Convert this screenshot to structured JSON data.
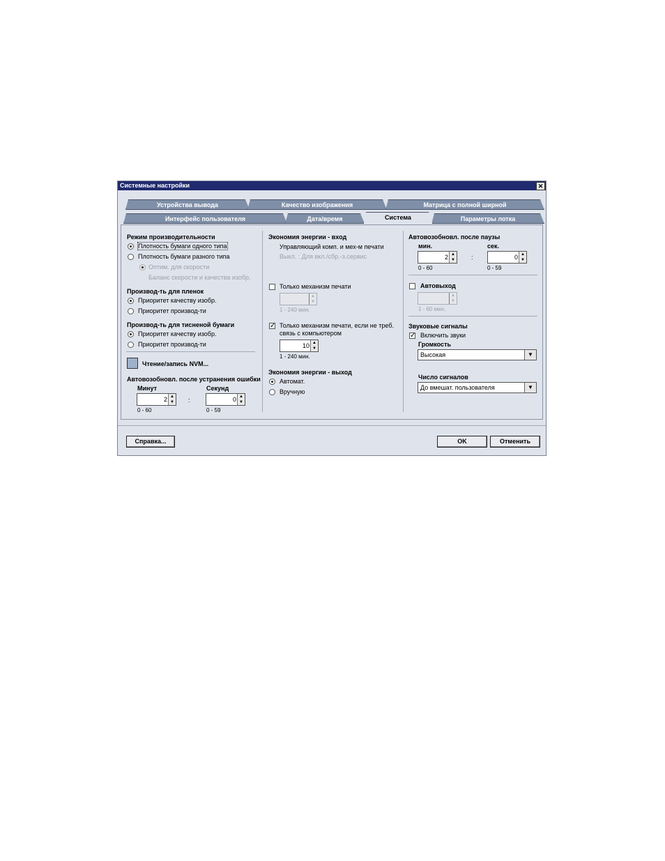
{
  "window": {
    "title": "Системные настройки",
    "close": "✕"
  },
  "tabs_row1": [
    "Устройства вывода",
    "Качество изображения",
    "Матрица с полной ширной"
  ],
  "tabs_row2": [
    "Интерфейс пользователя",
    "Дата/время",
    "Система",
    "Параметры лотка"
  ],
  "col1": {
    "perf_title": "Режим производительности",
    "perf_opt1": "Плотность бумаги одного типа",
    "perf_opt2": "Плотность бумаги разного типа",
    "perf_sub1": "Оптим. для скорости",
    "perf_sub2": "Баланс скорости и качества изобр.",
    "film_title": "Производ-ть для пленок",
    "film_opt1": "Приоритет качеству изобр.",
    "film_opt2": "Приоритет производ-ти",
    "emb_title": "Производ-ть для тисненой бумаги",
    "emb_opt1": "Приоритет качеству изобр.",
    "emb_opt2": "Приоритет производ-ти",
    "nvm": "Чтение/запись NVM...",
    "auto_title": "Автовозобновл. после устранения ошибки",
    "min_label": "Минут",
    "sec_label": "Секунд",
    "min_value": "2",
    "sec_value": "0",
    "colon": ":",
    "min_range": "0 - 60",
    "sec_range": "0 - 59"
  },
  "col2": {
    "eco_in_title": "Экономия энергии - вход",
    "eco_in_line1": "Управляющий комп. и мех-м печати",
    "eco_in_line2": "Выкл. : Для вкл./сбр.-з.сервис",
    "print_only": "Только механизм печати",
    "print_only_range": "1 - 240 мин.",
    "print_only_nocomp": "Только механизм печати, если не треб.",
    "print_only_nocomp2": "связь с компьютером",
    "nocomp_value": "10",
    "nocomp_range": "1 - 240 мин.",
    "eco_out_title": "Экономия энергии - выход",
    "eco_out_opt1": "Автомат.",
    "eco_out_opt2": "Вручную"
  },
  "col3": {
    "pause_title": "Автовозобновл. после паузы",
    "min_label": "мин.",
    "sec_label": "сек.",
    "min_value": "2",
    "sec_value": "0",
    "colon": ":",
    "min_range": "0 - 60",
    "sec_range": "0 - 59",
    "autologout": "Автовыход",
    "autologout_range": "1 - 60 мин.",
    "sound_title": "Звуковые сигналы",
    "sound_enable": "Включить звуки",
    "volume_label": "Громкость",
    "volume_value": "Высокая",
    "count_label": "Число сигналов",
    "count_value": "До вмешат. пользователя"
  },
  "buttons": {
    "help": "Справка...",
    "ok": "OK",
    "cancel": "Отменить"
  }
}
